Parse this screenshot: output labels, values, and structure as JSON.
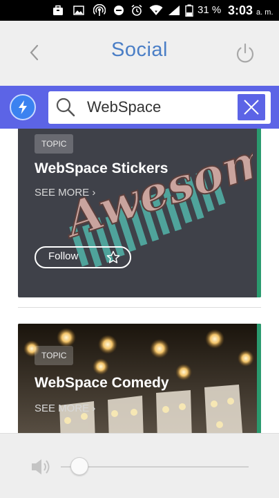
{
  "status_bar": {
    "battery_percent": "31 %",
    "time": "3:03",
    "ampm": "a. m."
  },
  "header": {
    "title": "Social",
    "back_icon": "chevron-left-icon",
    "power_icon": "power-icon"
  },
  "search": {
    "value": "WebSpace",
    "placeholder": "",
    "bolt_icon": "lightning-icon",
    "clear_icon": "close-icon"
  },
  "cards": [
    {
      "tag": "TOPIC",
      "title": "WebSpace Stickers",
      "see_more": "SEE MORE ›",
      "follow_label": "Follow",
      "art_text": "Awesome"
    },
    {
      "tag": "TOPIC",
      "title": "WebSpace Comedy",
      "see_more": "SEE MORE ›"
    }
  ],
  "colors": {
    "accent_blue": "#5c64e6",
    "title_blue": "#4a7ec6",
    "card_accent_green": "#2a9a6e"
  }
}
